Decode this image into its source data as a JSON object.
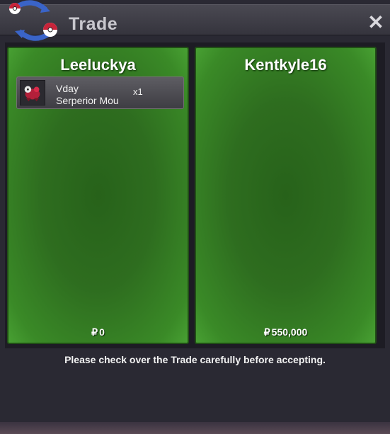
{
  "window": {
    "title": "Trade",
    "close_glyph": "✕",
    "logo_icon": "pokeball-exchange-icon"
  },
  "left_panel": {
    "player": "Leeluckya",
    "items": [
      {
        "line1": "Vday",
        "line2": "Serperior Mou",
        "qty": "x1",
        "icon": "serperior-mount-icon"
      }
    ],
    "money_symbol": "₽",
    "money": "0"
  },
  "right_panel": {
    "player": "Kentkyle16",
    "items": [],
    "money_symbol": "₽",
    "money": "550,000"
  },
  "notice": "Please check over the Trade carefully before accepting.",
  "colors": {
    "panel_green": "#2e6d1f",
    "panel_border": "#214f16",
    "window_bg": "#2a2933",
    "title_text": "#c8c7cd"
  }
}
